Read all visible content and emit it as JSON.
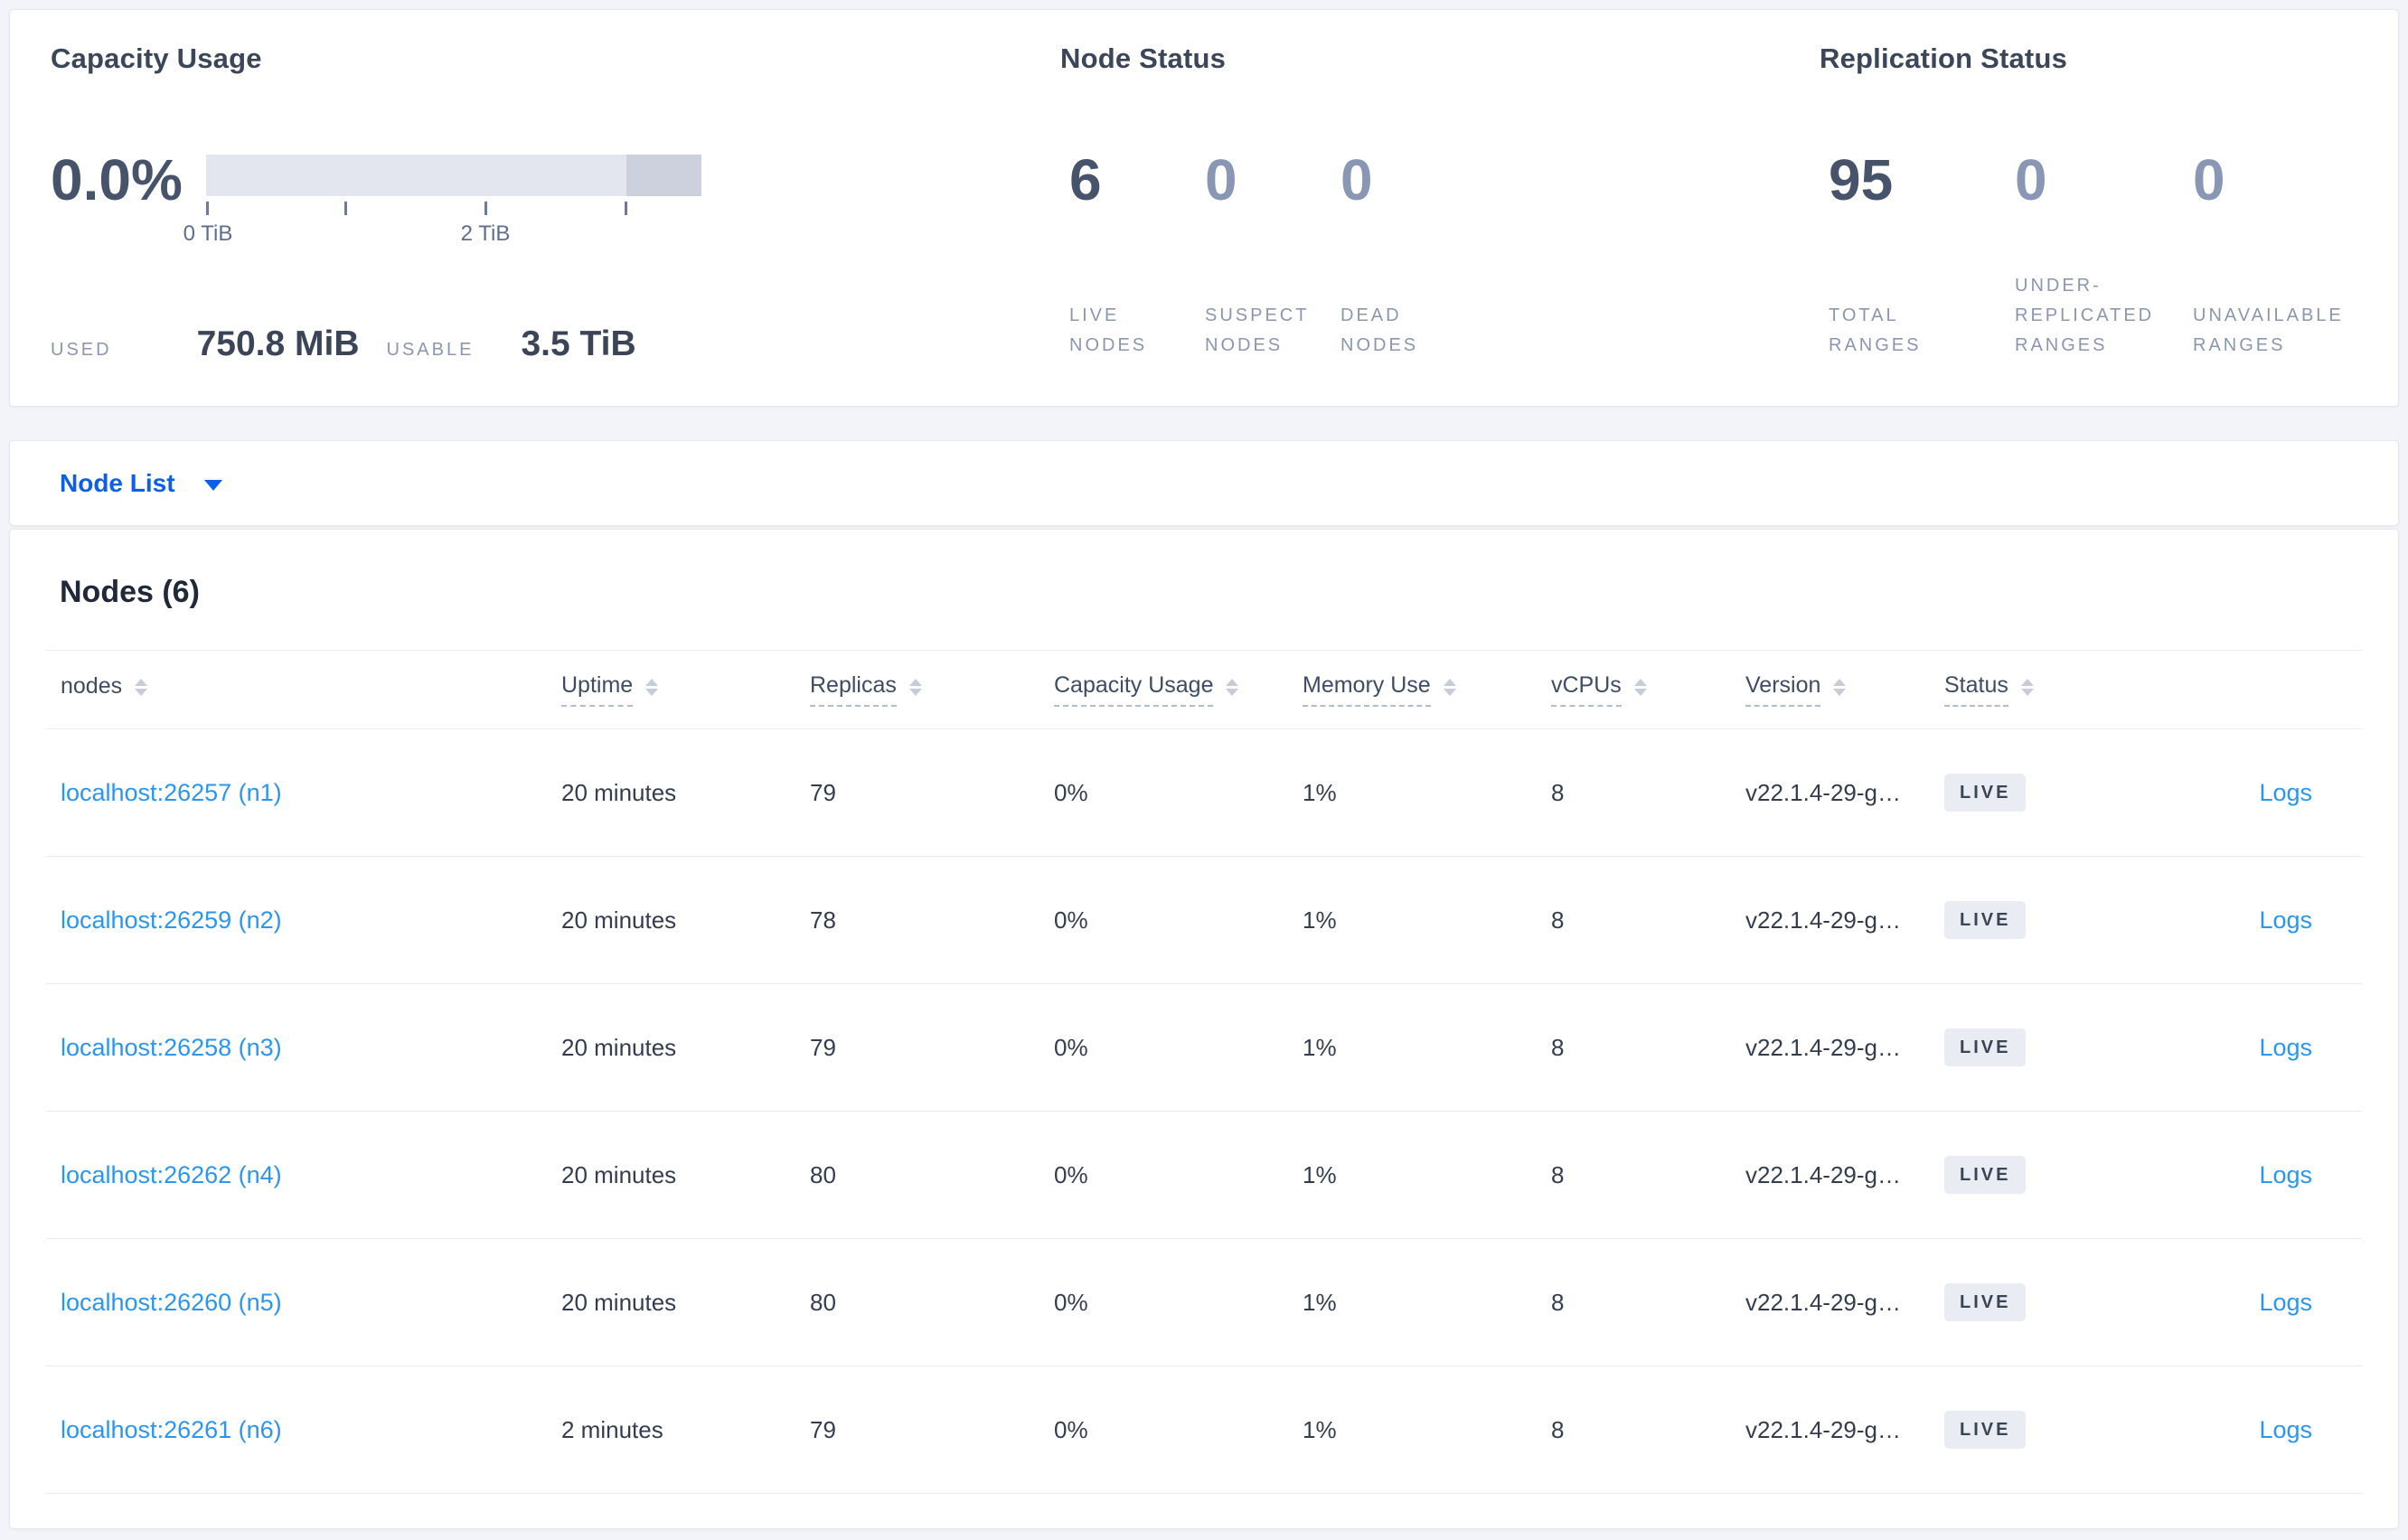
{
  "theme": {
    "page_bg": "#f3f4f9",
    "card_bg": "#ffffff",
    "accent_blue": "#0b5fe8",
    "link_blue": "#2b95f0",
    "dark_text": "#394455",
    "muted_label": "#8b96af",
    "bar_light": "#e3e6ee",
    "bar_dark": "#cdd1dd",
    "badge_bg": "#e9ecf2"
  },
  "summary": {
    "capacity": {
      "title": "Capacity Usage",
      "percent": "0.0%",
      "tick_label_0": "0 TiB",
      "tick_label_2": "2 TiB",
      "used_label": "USED",
      "used_value": "750.8 MiB",
      "usable_label": "USABLE",
      "usable_value": "3.5 TiB"
    },
    "node_status": {
      "title": "Node Status",
      "stats": [
        {
          "value": "6",
          "label": "LIVE NODES"
        },
        {
          "value": "0",
          "label": "SUSPECT NODES"
        },
        {
          "value": "0",
          "label": "DEAD NODES"
        }
      ]
    },
    "replication": {
      "title": "Replication Status",
      "stats": [
        {
          "value": "95",
          "label": "TOTAL RANGES"
        },
        {
          "value": "0",
          "label": "UNDER-REPLICATED RANGES"
        },
        {
          "value": "0",
          "label": "UNAVAILABLE RANGES"
        }
      ]
    }
  },
  "node_list": {
    "dropdown_label": "Node List"
  },
  "table": {
    "heading": "Nodes (6)",
    "columns": [
      "nodes",
      "Uptime",
      "Replicas",
      "Capacity Usage",
      "Memory Use",
      "vCPUs",
      "Version",
      "Status"
    ],
    "rows": [
      {
        "node": "localhost:26257 (n1)",
        "uptime": "20 minutes",
        "replicas": "79",
        "capacity": "0%",
        "memory": "1%",
        "vcpus": "8",
        "version": "v22.1.4-29-g…",
        "status": "LIVE",
        "logs": "Logs"
      },
      {
        "node": "localhost:26259 (n2)",
        "uptime": "20 minutes",
        "replicas": "78",
        "capacity": "0%",
        "memory": "1%",
        "vcpus": "8",
        "version": "v22.1.4-29-g…",
        "status": "LIVE",
        "logs": "Logs"
      },
      {
        "node": "localhost:26258 (n3)",
        "uptime": "20 minutes",
        "replicas": "79",
        "capacity": "0%",
        "memory": "1%",
        "vcpus": "8",
        "version": "v22.1.4-29-g…",
        "status": "LIVE",
        "logs": "Logs"
      },
      {
        "node": "localhost:26262 (n4)",
        "uptime": "20 minutes",
        "replicas": "80",
        "capacity": "0%",
        "memory": "1%",
        "vcpus": "8",
        "version": "v22.1.4-29-g…",
        "status": "LIVE",
        "logs": "Logs"
      },
      {
        "node": "localhost:26260 (n5)",
        "uptime": "20 minutes",
        "replicas": "80",
        "capacity": "0%",
        "memory": "1%",
        "vcpus": "8",
        "version": "v22.1.4-29-g…",
        "status": "LIVE",
        "logs": "Logs"
      },
      {
        "node": "localhost:26261 (n6)",
        "uptime": "2 minutes",
        "replicas": "79",
        "capacity": "0%",
        "memory": "1%",
        "vcpus": "8",
        "version": "v22.1.4-29-g…",
        "status": "LIVE",
        "logs": "Logs"
      }
    ]
  }
}
